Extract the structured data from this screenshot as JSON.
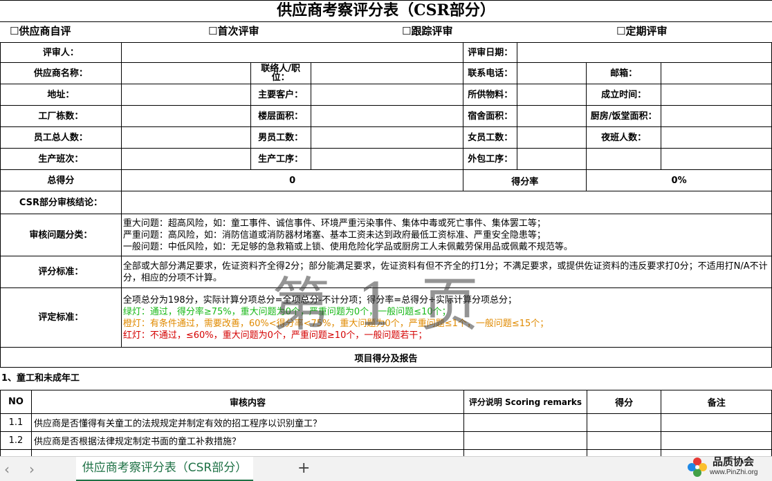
{
  "title": "供应商考察评分表（CSR部分）",
  "review_types": [
    "☐供应商自评",
    "☐首次评审",
    "☐跟踪评审",
    "☐定期评审"
  ],
  "form": {
    "reviewer": "评审人：",
    "review_date": "评审日期：",
    "supplier_name": "供应商名称：",
    "contact": "联络人/职位：",
    "phone": "联系电话：",
    "email": "邮箱：",
    "address": "地址：",
    "main_customers": "主要客户：",
    "materials": "所供物料：",
    "established": "成立时间：",
    "buildings": "工厂栋数：",
    "floor_area": "楼层面积：",
    "dorm_area": "宿舍面积：",
    "kitchen_area": "厨房/饭堂面积：",
    "total_staff": "员工总人数：",
    "male_staff": "男员工数：",
    "female_staff": "女员工数：",
    "night_shift": "夜班人数：",
    "shifts": "生产班次：",
    "process": "生产工序：",
    "outsourced": "外包工序：",
    "total_score_label": "总得分",
    "total_score_value": "0",
    "rate_label": "得分率",
    "rate_value": "0%",
    "conclusion_label": "CSR部分审核结论：",
    "category_label": "审核问题分类：",
    "category_lines": [
      "重大问题：超高风险，如：童工事件、诚信事件、环境严重污染事件、集体中毒或死亡事件、集体罢工等；",
      "严重问题：高风险，如：消防信道或消防器材堵塞、基本工资未达到政府最低工资标准、严重安全隐患等；",
      "一般问题：中低风险，如：无足够的急救箱或上锁、使用危险化学品或厨房工人未佩戴劳保用品或佩戴不规范等。"
    ],
    "scoring_label": "评分标准：",
    "scoring_text": "全部或大部分满足要求，佐证资料齐全得2分；部分能满足要求，佐证资料有但不齐全的打1分；不满足要求，或提供佐证资料的违反要求打0分；不适用打N/A不计分，相应的分项不计算。",
    "rating_label": "评定标准：",
    "rating_lines": {
      "intro": "全项总分为198分，实际计算分项总分=全项总分-不计分项；得分率=总得分÷实际计算分项总分；",
      "green": "绿灯：通过，得分率≥75%，重大问题为0个，严重问题为0个，一般问题≤10个；",
      "orange": "橙灯：有条件通过，需要改善，60%<得分率<75%，重大问题为0个，严重问题≤1个，一般问题≤15个；",
      "red": "红灯：不通过，≤60%，重大问题为0个，严重问题≥10个，一般问题若干；"
    },
    "report_header": "项目得分及报告"
  },
  "watermark": "第 1 页",
  "section_title": "1、童工和未成年工",
  "items_header": {
    "no": "NO",
    "content": "审核内容",
    "remarks": "评分说明 Scoring remarks",
    "score": "得分",
    "note": "备注"
  },
  "items": [
    {
      "no": "1.1",
      "content": "供应商是否懂得有关童工的法规规定并制定有效的招工程序以识别童工？"
    },
    {
      "no": "1.2",
      "content": "供应商是否根据法律规定制定书面的童工补救措施？"
    }
  ],
  "tabs": {
    "sheet_name": "供应商考察评分表（CSR部分）",
    "add": "+",
    "prev": "‹",
    "next": "›"
  },
  "logo": {
    "brand": "品质协会",
    "url": "www.PinZhi.org"
  }
}
